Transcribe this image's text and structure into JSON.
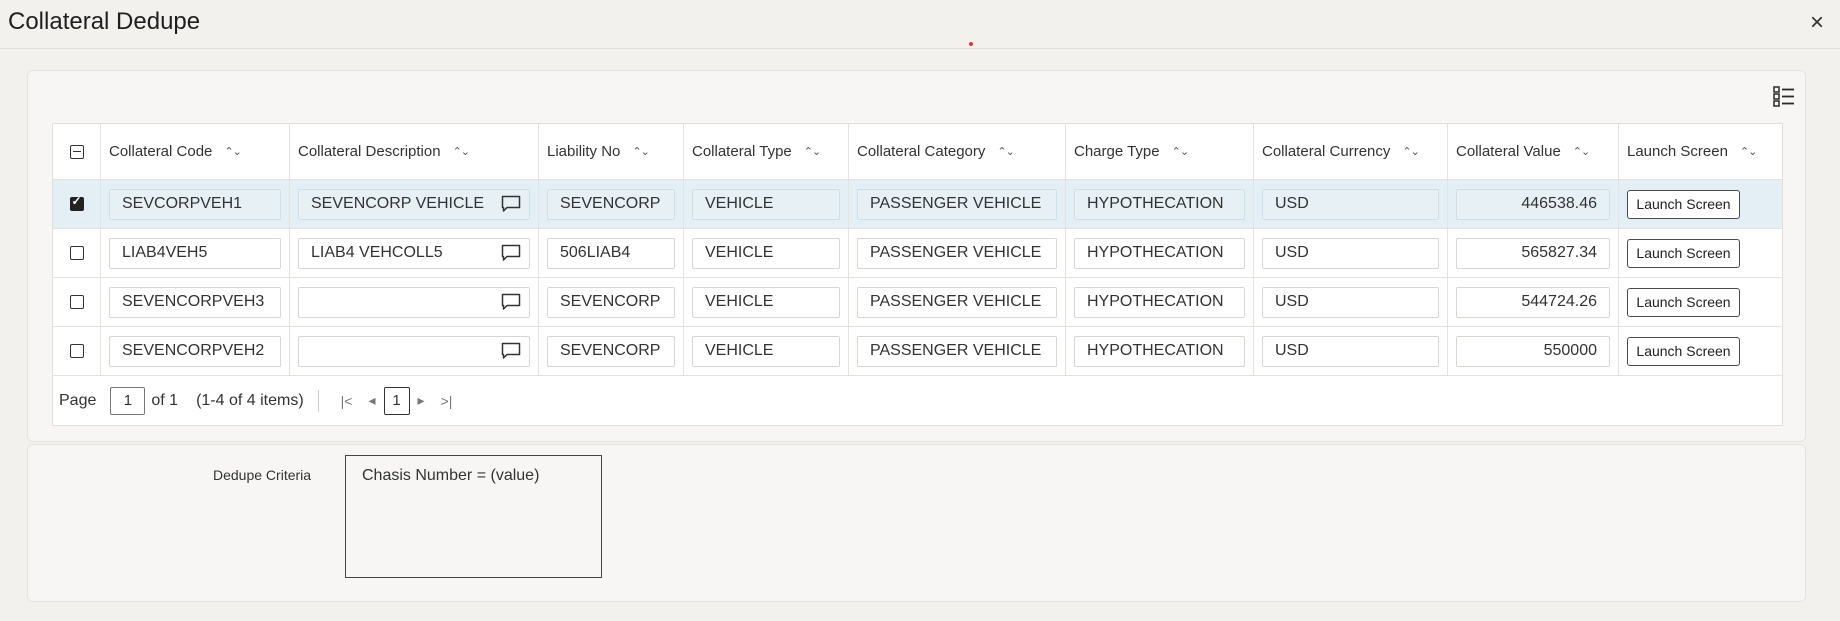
{
  "window": {
    "title": "Collateral Dedupe",
    "close_icon": "×"
  },
  "table": {
    "columns": [
      "Collateral Code",
      "Collateral Description",
      "Liability No",
      "Collateral Type",
      "Collateral Category",
      "Charge Type",
      "Collateral Currency",
      "Collateral Value",
      "Launch Screen"
    ],
    "rows": [
      {
        "code": "SEVCORPVEH1",
        "description": "SEVENCORP VEHICLE",
        "liability": "SEVENCORP",
        "type": "VEHICLE",
        "category": "PASSENGER VEHICLE",
        "charge": "HYPOTHECATION",
        "currency": "USD",
        "value": "446538.46",
        "launch": "Launch Screen",
        "checked": true
      },
      {
        "code": "LIAB4VEH5",
        "description": "LIAB4 VEHCOLL5",
        "liability": "506LIAB4",
        "type": "VEHICLE",
        "category": "PASSENGER VEHICLE",
        "charge": "HYPOTHECATION",
        "currency": "USD",
        "value": "565827.34",
        "launch": "Launch Screen",
        "checked": false
      },
      {
        "code": "SEVENCORPVEH3",
        "description": "",
        "liability": "SEVENCORP",
        "type": "VEHICLE",
        "category": "PASSENGER VEHICLE",
        "charge": "HYPOTHECATION",
        "currency": "USD",
        "value": "544724.26",
        "launch": "Launch Screen",
        "checked": false
      },
      {
        "code": "SEVENCORPVEH2",
        "description": "",
        "liability": "SEVENCORP",
        "type": "VEHICLE",
        "category": "PASSENGER VEHICLE",
        "charge": "HYPOTHECATION",
        "currency": "USD",
        "value": "550000",
        "launch": "Launch Screen",
        "checked": false
      }
    ]
  },
  "pager": {
    "page_label": "Page",
    "page_value": "1",
    "of_label": "of 1",
    "items_label": "(1-4 of 4 items)",
    "current_page": "1"
  },
  "criteria": {
    "label": "Dedupe Criteria",
    "value": "Chasis Number = (value)"
  },
  "colors": {
    "selected_row": "#e4eff5",
    "background": "#f3f1ee",
    "accent_dot": "#e3342f"
  }
}
